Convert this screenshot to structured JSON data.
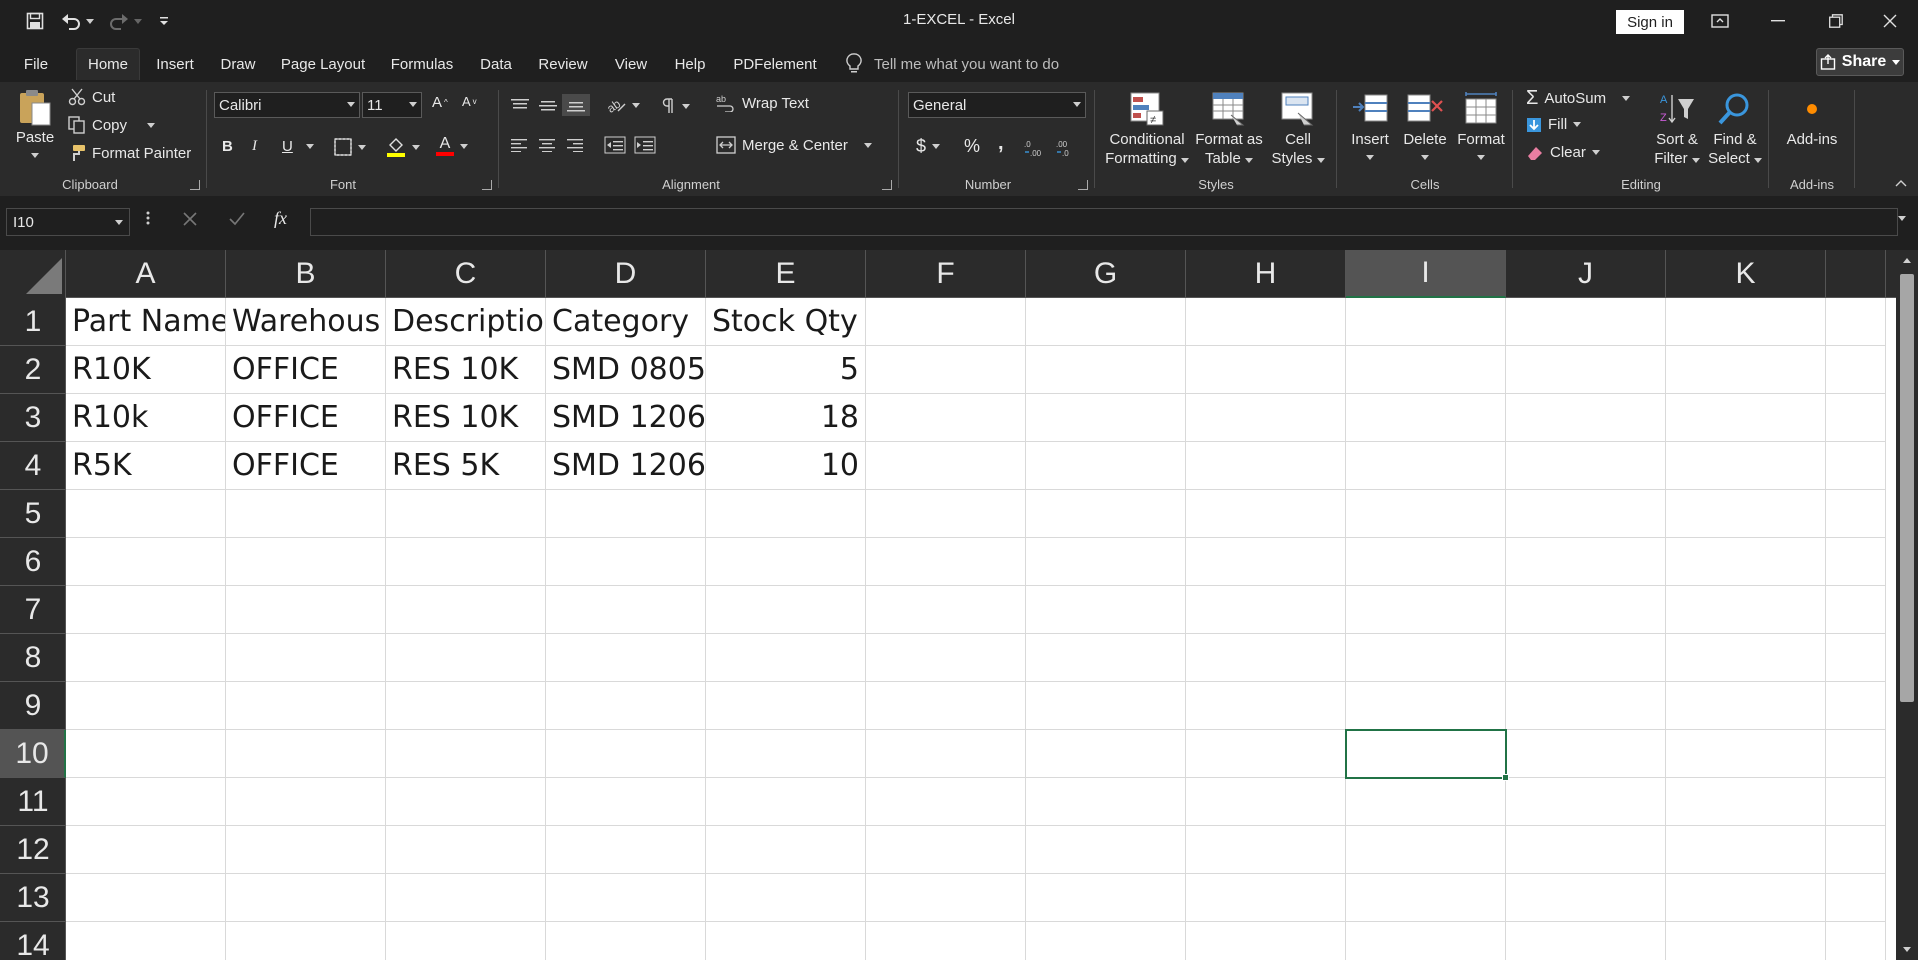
{
  "window": {
    "title": "1-EXCEL  -  Excel",
    "signin_label": "Sign in"
  },
  "menu": {
    "tabs": [
      "File",
      "Home",
      "Insert",
      "Draw",
      "Page Layout",
      "Formulas",
      "Data",
      "Review",
      "View",
      "Help",
      "PDFelement"
    ],
    "active_tab": "Home",
    "tell_me_placeholder": "Tell me what you want to do",
    "share_label": "Share"
  },
  "ribbon": {
    "clipboard": {
      "label": "Clipboard",
      "paste": "Paste",
      "cut": "Cut",
      "copy": "Copy",
      "format_painter": "Format Painter"
    },
    "font": {
      "label": "Font",
      "font_name": "Calibri",
      "font_size": "11",
      "bold": "B",
      "italic": "I",
      "underline": "U",
      "grow": "A",
      "shrink": "A",
      "font_color": "A",
      "fill_color_hex": "#ffff00",
      "font_color_hex": "#ff0000"
    },
    "alignment": {
      "label": "Alignment",
      "wrap_text": "Wrap Text",
      "merge_center": "Merge & Center"
    },
    "number": {
      "label": "Number",
      "format": "General",
      "currency": "$",
      "percent": "%",
      "comma": ","
    },
    "styles": {
      "label": "Styles",
      "conditional_formatting": [
        "Conditional",
        "Formatting"
      ],
      "format_as_table": [
        "Format as",
        "Table"
      ],
      "cell_styles": [
        "Cell",
        "Styles"
      ]
    },
    "cells": {
      "label": "Cells",
      "insert": "Insert",
      "delete": "Delete",
      "format": "Format"
    },
    "editing": {
      "label": "Editing",
      "autosum": "AutoSum",
      "fill": "Fill",
      "clear": "Clear",
      "sort_filter": [
        "Sort &",
        "Filter"
      ],
      "find_select": [
        "Find &",
        "Select"
      ]
    },
    "addins": {
      "label": "Add-ins",
      "addins": "Add-ins"
    }
  },
  "formula_bar": {
    "name_box": "I10",
    "fx": "fx",
    "value": ""
  },
  "sheet": {
    "columns": [
      "A",
      "B",
      "C",
      "D",
      "E",
      "F",
      "G",
      "H",
      "I",
      "J",
      "K"
    ],
    "rows": [
      "1",
      "2",
      "3",
      "4",
      "5",
      "6",
      "7",
      "8",
      "9",
      "10",
      "11",
      "12",
      "13",
      "14"
    ],
    "selected_column": "I",
    "selected_row": "10",
    "cells": [
      [
        "Part Name",
        "Warehous",
        "Descriptio",
        "Category",
        "Stock Qty"
      ],
      [
        "R10K",
        "OFFICE",
        "RES 10K",
        "SMD 0805",
        "5"
      ],
      [
        "R10k",
        "OFFICE",
        "RES 10K",
        "SMD 1206",
        "18"
      ],
      [
        "R5K",
        "OFFICE",
        "RES 5K",
        "SMD 1206",
        "10"
      ]
    ],
    "accent_color": "#217346"
  }
}
